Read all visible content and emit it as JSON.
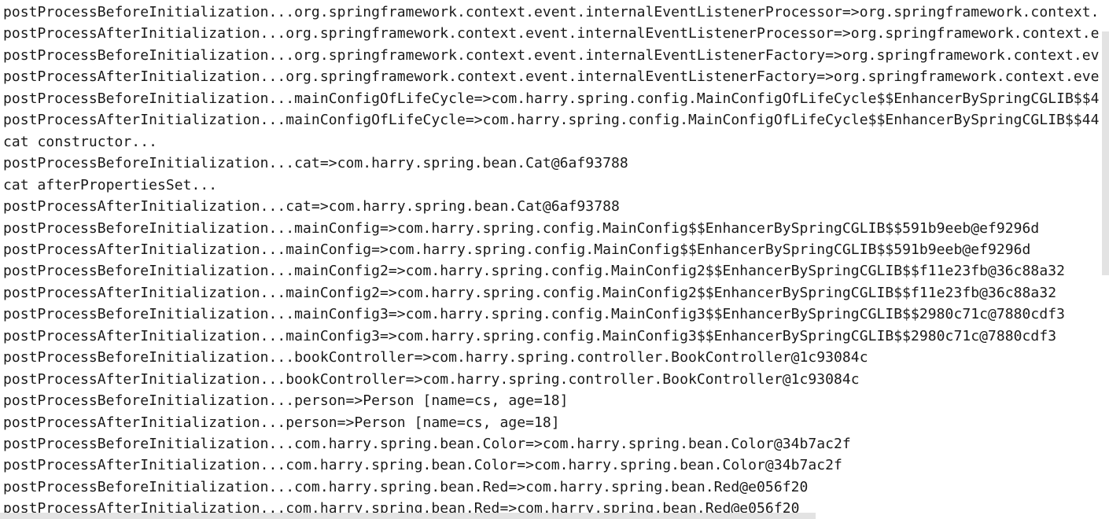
{
  "console": {
    "lines": [
      "postProcessBeforeInitialization...org.springframework.context.event.internalEventListenerProcessor=>org.springframework.context.",
      "postProcessAfterInitialization...org.springframework.context.event.internalEventListenerProcessor=>org.springframework.context.e",
      "postProcessBeforeInitialization...org.springframework.context.event.internalEventListenerFactory=>org.springframework.context.ev",
      "postProcessAfterInitialization...org.springframework.context.event.internalEventListenerFactory=>org.springframework.context.eve",
      "postProcessBeforeInitialization...mainConfigOfLifeCycle=>com.harry.spring.config.MainConfigOfLifeCycle$$EnhancerBySpringCGLIB$$4",
      "postProcessAfterInitialization...mainConfigOfLifeCycle=>com.harry.spring.config.MainConfigOfLifeCycle$$EnhancerBySpringCGLIB$$44",
      "cat constructor...",
      "postProcessBeforeInitialization...cat=>com.harry.spring.bean.Cat@6af93788",
      "cat afterPropertiesSet...",
      "postProcessAfterInitialization...cat=>com.harry.spring.bean.Cat@6af93788",
      "postProcessBeforeInitialization...mainConfig=>com.harry.spring.config.MainConfig$$EnhancerBySpringCGLIB$$591b9eeb@ef9296d",
      "postProcessAfterInitialization...mainConfig=>com.harry.spring.config.MainConfig$$EnhancerBySpringCGLIB$$591b9eeb@ef9296d",
      "postProcessBeforeInitialization...mainConfig2=>com.harry.spring.config.MainConfig2$$EnhancerBySpringCGLIB$$f11e23fb@36c88a32",
      "postProcessAfterInitialization...mainConfig2=>com.harry.spring.config.MainConfig2$$EnhancerBySpringCGLIB$$f11e23fb@36c88a32",
      "postProcessBeforeInitialization...mainConfig3=>com.harry.spring.config.MainConfig3$$EnhancerBySpringCGLIB$$2980c71c@7880cdf3",
      "postProcessAfterInitialization...mainConfig3=>com.harry.spring.config.MainConfig3$$EnhancerBySpringCGLIB$$2980c71c@7880cdf3",
      "postProcessBeforeInitialization...bookController=>com.harry.spring.controller.BookController@1c93084c",
      "postProcessAfterInitialization...bookController=>com.harry.spring.controller.BookController@1c93084c",
      "postProcessBeforeInitialization...person=>Person [name=cs, age=18]",
      "postProcessAfterInitialization...person=>Person [name=cs, age=18]",
      "postProcessBeforeInitialization...com.harry.spring.bean.Color=>com.harry.spring.bean.Color@34b7ac2f",
      "postProcessAfterInitialization...com.harry.spring.bean.Color=>com.harry.spring.bean.Color@34b7ac2f",
      "postProcessBeforeInitialization...com.harry.spring.bean.Red=>com.harry.spring.bean.Red@e056f20",
      "postProcessAfterInitialization...com.harry.spring.bean.Red=>com.harry.spring.bean.Red@e056f20"
    ]
  }
}
